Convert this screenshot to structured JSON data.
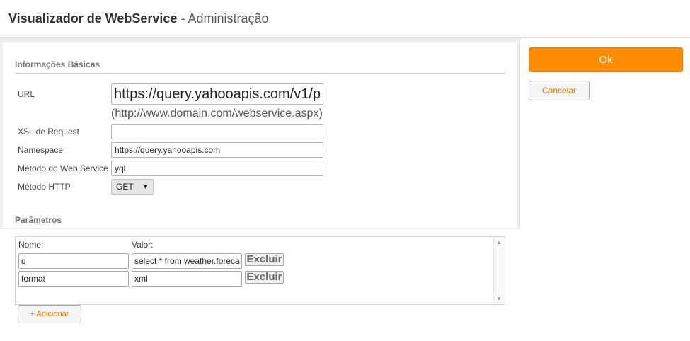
{
  "header": {
    "title": "Visualizador de WebService",
    "separator": " - ",
    "subtitle": "Administração"
  },
  "basic_info": {
    "section_title": "Informações Básicas",
    "url_label": "URL",
    "url_value": "https://query.yahooapis.com/v1/p",
    "url_hint": "(http://www.domain.com/webservice.aspx)",
    "xsl_label": "XSL de Request",
    "xsl_value": "",
    "namespace_label": "Namespace",
    "namespace_value": "https://query.yahooapis.com",
    "method_label": "Método do Web Service",
    "method_value": "yql",
    "http_label": "Método HTTP",
    "http_selected": "GET"
  },
  "params": {
    "section_title": "Parâmetros",
    "name_header": "Nome:",
    "value_header": "Valor:",
    "rows": [
      {
        "name": "q",
        "value": "select * from weather.foreca",
        "delete_label": "Excluir"
      },
      {
        "name": "format",
        "value": "xml",
        "delete_label": "Excluir"
      }
    ],
    "add_label": "+ Adicionar"
  },
  "actions": {
    "ok_label": "Ok",
    "cancel_label": "Cancelar"
  },
  "colors": {
    "accent": "#ff8c00",
    "link_text": "#e07800"
  }
}
